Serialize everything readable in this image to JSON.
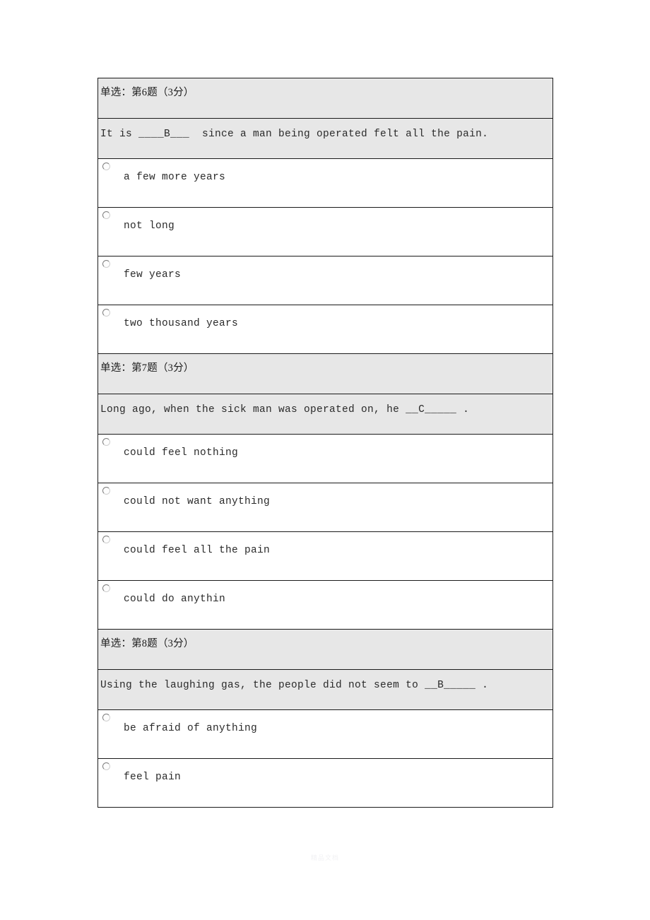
{
  "document": {
    "watermark": "精品文档"
  },
  "questions": [
    {
      "header": "单选：第6题（3分）",
      "stem": "It is ____B___  since a man being operated felt all the pain.",
      "options": [
        {
          "label": "a few more years",
          "selected": false
        },
        {
          "label": "not long",
          "selected": false
        },
        {
          "label": "few years",
          "selected": false
        },
        {
          "label": "two thousand years",
          "selected": false
        }
      ]
    },
    {
      "header": "单选：第7题（3分）",
      "stem": "Long ago, when the sick man was operated on, he __C_____ .",
      "options": [
        {
          "label": "could feel nothing",
          "selected": false
        },
        {
          "label": "could not want anything",
          "selected": false
        },
        {
          "label": "could feel all the pain",
          "selected": false
        },
        {
          "label": "could do anythin",
          "selected": false
        }
      ]
    },
    {
      "header": "单选：第8题（3分）",
      "stem": "Using the laughing gas, the people did not seem to __B_____ .",
      "options": [
        {
          "label": "be afraid of anything",
          "selected": false
        },
        {
          "label": "feel pain",
          "selected": false
        }
      ]
    }
  ]
}
